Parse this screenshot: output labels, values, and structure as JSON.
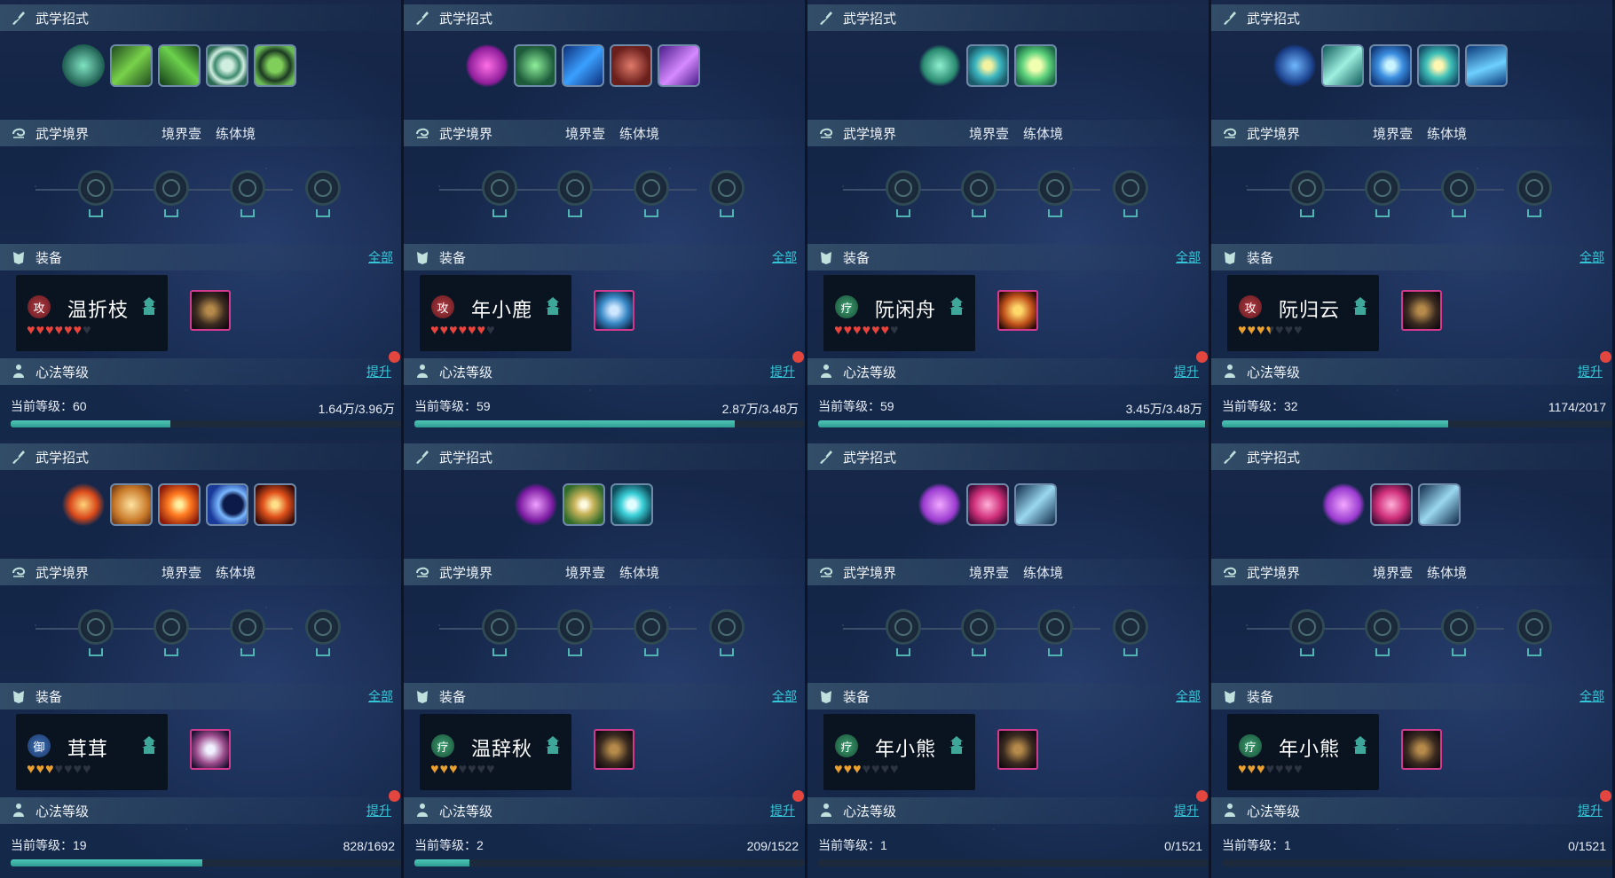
{
  "labels": {
    "skills_header": "武学招式",
    "realm_header": "武学境界",
    "realm_level": "境界壹",
    "realm_stage": "练体境",
    "equip_header": "装备",
    "equip_all": "全部",
    "xinfa_header": "心法等级",
    "xinfa_upgrade": "提升",
    "level_prefix": "当前等级："
  },
  "colors": {
    "accent_link": "#35c8d8",
    "progress_fill": "#3fb5a8",
    "heart_red": "#e8443d",
    "heart_gold": "#eaa02e",
    "notice_dot": "#e2463f"
  },
  "panels": [
    {
      "name": "温折枝",
      "role_icon": "攻",
      "role": "attack",
      "stars": 6,
      "star_color": "red",
      "level": "60",
      "exp": "1.64万/3.96万",
      "progress": 0.41,
      "skills": [
        "spirit-icon",
        "claw-slash-icon",
        "blade-strike-icon",
        "vortex-ring-icon",
        "taiji-icon"
      ],
      "equip": "dark-armor-icon"
    },
    {
      "name": "年小鹿",
      "role_icon": "攻",
      "role": "attack",
      "stars": 6,
      "star_color": "red",
      "level": "59",
      "exp": "2.87万/3.48万",
      "progress": 0.82,
      "skills": [
        "purple-orb-icon",
        "green-burst-icon",
        "blue-serpent-icon",
        "red-scale-icon",
        "violet-flame-icon"
      ],
      "equip": "blue-armor-icon"
    },
    {
      "name": "阮闲舟",
      "role_icon": "疗",
      "role": "healer",
      "stars": 6,
      "star_color": "red",
      "level": "59",
      "exp": "3.45万/3.48万",
      "progress": 0.99,
      "skills": [
        "leaf-spirit-icon",
        "water-flower-icon",
        "lotus-icon"
      ],
      "equip": "gold-armor-icon"
    },
    {
      "name": "阮归云",
      "role_icon": "攻",
      "role": "attack",
      "stars": 3.5,
      "star_color": "gold",
      "level": "32",
      "exp": "1174/2017",
      "progress": 0.58,
      "skills": [
        "wave-spirit-icon",
        "wind-slash-icon",
        "whirlpool-icon",
        "star-flower-icon",
        "tide-icon"
      ],
      "equip": "dark-armor-icon"
    },
    {
      "name": "茸茸",
      "role_icon": "御",
      "role": "defense",
      "stars": 3,
      "star_color": "gold",
      "level": "19",
      "exp": "828/1692",
      "progress": 0.49,
      "skills": [
        "fire-figure-icon",
        "buddha-icon",
        "explosion-icon",
        "crescent-icon",
        "fire-swirl-icon"
      ],
      "equip": "silver-armor-icon"
    },
    {
      "name": "温辞秋",
      "role_icon": "疗",
      "role": "healer",
      "stars": 3,
      "star_color": "gold",
      "level": "2",
      "exp": "209/1522",
      "progress": 0.14,
      "skills": [
        "purple-dancer-icon",
        "light-rays-icon",
        "cyan-ring-icon"
      ],
      "equip": "dark-armor-icon"
    },
    {
      "name": "年小熊",
      "role_icon": "疗",
      "role": "healer",
      "stars": 3,
      "star_color": "gold",
      "level": "1",
      "exp": "0/1521",
      "progress": 0.0,
      "skills": [
        "crystal-icon",
        "pink-beast-icon",
        "shark-fin-icon"
      ],
      "equip": "dark-armor-icon"
    },
    {
      "name": "年小熊",
      "role_icon": "疗",
      "role": "healer",
      "stars": 3,
      "star_color": "gold",
      "level": "1",
      "exp": "0/1521",
      "progress": 0.0,
      "skills": [
        "crystal-icon",
        "pink-beast-icon",
        "shark-fin-icon"
      ],
      "equip": "dark-armor-icon"
    }
  ]
}
